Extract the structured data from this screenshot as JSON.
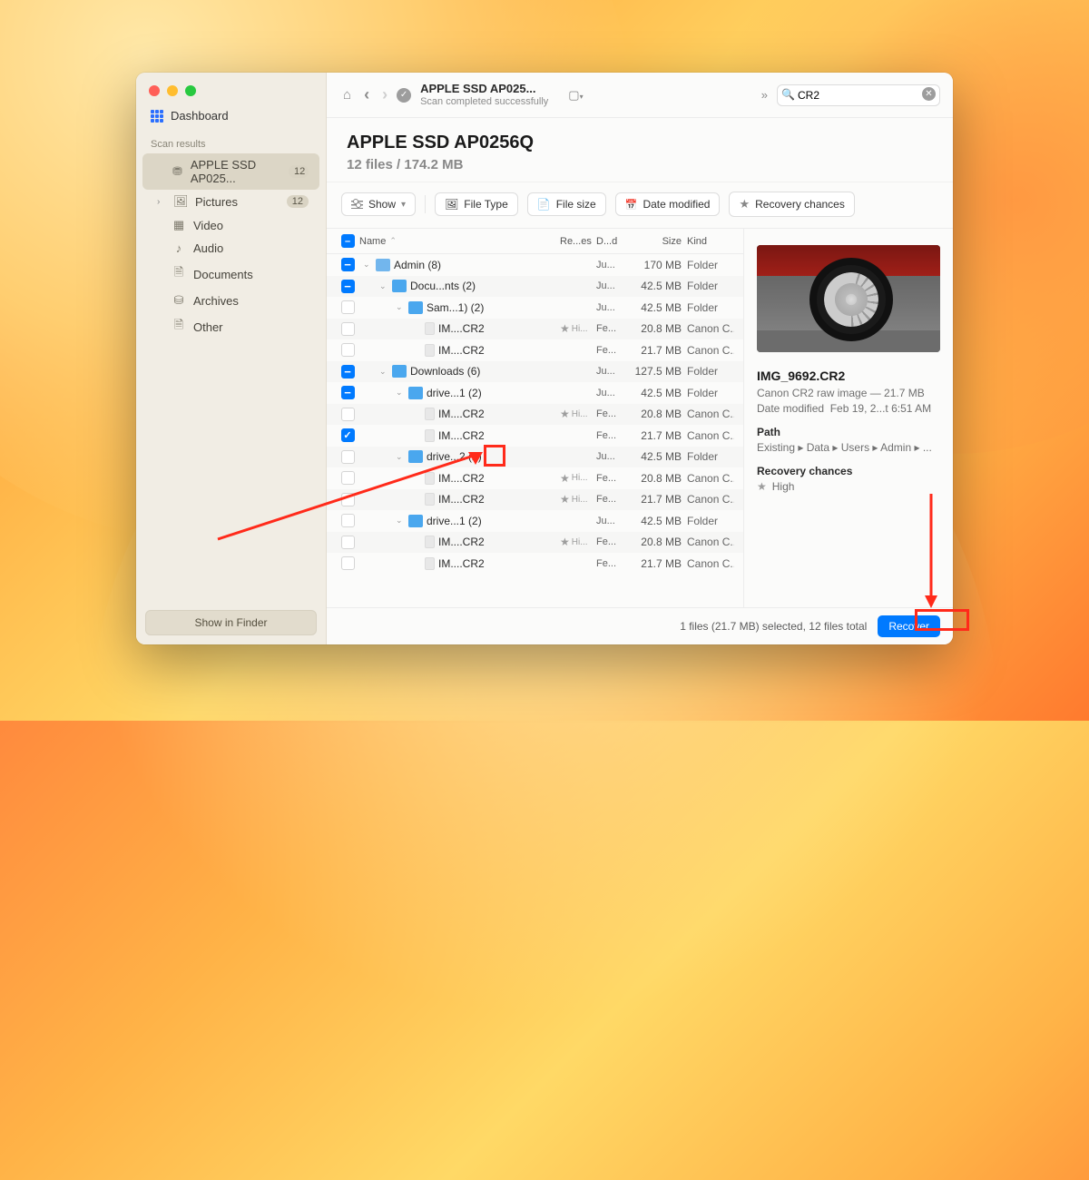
{
  "sidebar": {
    "dashboard": "Dashboard",
    "section": "Scan results",
    "items": [
      {
        "icon": "drive",
        "label": "APPLE SSD AP025...",
        "badge": "12",
        "selected": true
      },
      {
        "icon": "pictures",
        "label": "Pictures",
        "badge": "12",
        "expandable": true
      },
      {
        "icon": "video",
        "label": "Video",
        "indent": true
      },
      {
        "icon": "audio",
        "label": "Audio",
        "indent": true
      },
      {
        "icon": "documents",
        "label": "Documents",
        "indent": true
      },
      {
        "icon": "archives",
        "label": "Archives",
        "indent": true
      },
      {
        "icon": "other",
        "label": "Other",
        "indent": true
      }
    ],
    "show_finder": "Show in Finder"
  },
  "toolbar": {
    "title": "APPLE SSD AP025...",
    "subtitle": "Scan completed successfully",
    "search_value": "CR2"
  },
  "header": {
    "title": "APPLE SSD AP0256Q",
    "subtitle": "12 files / 174.2 MB"
  },
  "filters": {
    "show": "Show",
    "filetype": "File Type",
    "filesize": "File size",
    "datemod": "Date modified",
    "recchances": "Recovery chances"
  },
  "columns": {
    "name": "Name",
    "rec": "Re...es",
    "date": "D...d",
    "size": "Size",
    "kind": "Kind"
  },
  "rows": [
    {
      "cb": "minus",
      "ind": 0,
      "disc": "down",
      "ico": "user",
      "name": "Admin (8)",
      "rec": "",
      "date": "Ju...",
      "size": "170 MB",
      "kind": "Folder"
    },
    {
      "cb": "minus",
      "ind": 1,
      "disc": "down",
      "ico": "folder",
      "name": "Docu...nts (2)",
      "rec": "",
      "date": "Ju...",
      "size": "42.5 MB",
      "kind": "Folder"
    },
    {
      "cb": "none",
      "ind": 2,
      "disc": "down",
      "ico": "folder",
      "name": "Sam...1) (2)",
      "rec": "",
      "date": "Ju...",
      "size": "42.5 MB",
      "kind": "Folder"
    },
    {
      "cb": "none",
      "ind": 3,
      "disc": "none",
      "ico": "file",
      "name": "IM....CR2",
      "rec": "Hi...",
      "date": "Fe...",
      "size": "20.8 MB",
      "kind": "Canon C..."
    },
    {
      "cb": "none",
      "ind": 3,
      "disc": "none",
      "ico": "file",
      "name": "IM....CR2",
      "rec": "",
      "date": "Fe...",
      "size": "21.7 MB",
      "kind": "Canon C..."
    },
    {
      "cb": "minus",
      "ind": 1,
      "disc": "down",
      "ico": "dl",
      "name": "Downloads (6)",
      "rec": "",
      "date": "Ju...",
      "size": "127.5 MB",
      "kind": "Folder"
    },
    {
      "cb": "minus",
      "ind": 2,
      "disc": "down",
      "ico": "folder",
      "name": "drive...1 (2)",
      "rec": "",
      "date": "Ju...",
      "size": "42.5 MB",
      "kind": "Folder"
    },
    {
      "cb": "none",
      "ind": 3,
      "disc": "none",
      "ico": "file",
      "name": "IM....CR2",
      "rec": "Hi...",
      "date": "Fe...",
      "size": "20.8 MB",
      "kind": "Canon C..."
    },
    {
      "cb": "full",
      "ind": 3,
      "disc": "none",
      "ico": "file",
      "name": "IM....CR2",
      "rec": "",
      "date": "Fe...",
      "size": "21.7 MB",
      "kind": "Canon C..."
    },
    {
      "cb": "none",
      "ind": 2,
      "disc": "down",
      "ico": "folder",
      "name": "drive...2 (2)",
      "rec": "",
      "date": "Ju...",
      "size": "42.5 MB",
      "kind": "Folder"
    },
    {
      "cb": "none",
      "ind": 3,
      "disc": "none",
      "ico": "file",
      "name": "IM....CR2",
      "rec": "Hi...",
      "date": "Fe...",
      "size": "20.8 MB",
      "kind": "Canon C..."
    },
    {
      "cb": "none",
      "ind": 3,
      "disc": "none",
      "ico": "file",
      "name": "IM....CR2",
      "rec": "Hi...",
      "date": "Fe...",
      "size": "21.7 MB",
      "kind": "Canon C..."
    },
    {
      "cb": "none",
      "ind": 2,
      "disc": "down",
      "ico": "folder",
      "name": "drive...1 (2)",
      "rec": "",
      "date": "Ju...",
      "size": "42.5 MB",
      "kind": "Folder"
    },
    {
      "cb": "none",
      "ind": 3,
      "disc": "none",
      "ico": "file",
      "name": "IM....CR2",
      "rec": "Hi...",
      "date": "Fe...",
      "size": "20.8 MB",
      "kind": "Canon C..."
    },
    {
      "cb": "none",
      "ind": 3,
      "disc": "none",
      "ico": "file",
      "name": "IM....CR2",
      "rec": "",
      "date": "Fe...",
      "size": "21.7 MB",
      "kind": "Canon C..."
    }
  ],
  "preview": {
    "filename": "IMG_9692.CR2",
    "meta1": "Canon CR2 raw image — 21.7 MB",
    "meta2_label": "Date modified",
    "meta2_value": "Feb 19, 2...t 6:51 AM",
    "path_label": "Path",
    "path_value": "Existing ▸ Data ▸ Users ▸ Admin ▸ ...",
    "rc_label": "Recovery chances",
    "rc_value": "High"
  },
  "footer": {
    "status": "1 files (21.7 MB) selected, 12 files total",
    "recover": "Recover"
  }
}
